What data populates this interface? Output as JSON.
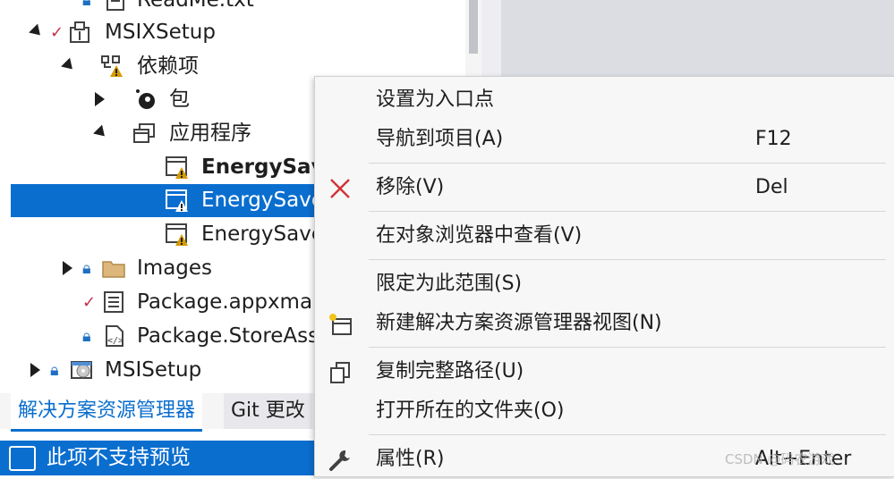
{
  "tree": {
    "rows": [
      {
        "label": "ReadMe.txt",
        "icon": "text-file-icon"
      },
      {
        "label": "MSIXSetup",
        "icon": "package-project-icon"
      },
      {
        "label": "依赖项",
        "icon": "dependencies-warning-icon"
      },
      {
        "label": "包",
        "icon": "package-icon"
      },
      {
        "label": "应用程序",
        "icon": "applications-icon"
      },
      {
        "label": "EnergySav",
        "icon": "app-warning-icon"
      },
      {
        "label": "EnergySave",
        "icon": "app-warning-icon"
      },
      {
        "label": "EnergySave",
        "icon": "app-warning-icon"
      },
      {
        "label": "Images",
        "icon": "folder-icon"
      },
      {
        "label": "Package.appxmar",
        "icon": "manifest-icon"
      },
      {
        "label": "Package.StoreAss",
        "icon": "xml-file-icon"
      },
      {
        "label": "MSISetup",
        "icon": "setup-project-icon"
      }
    ]
  },
  "tabs": {
    "solution_explorer": "解决方案资源管理器",
    "git": "Git 更改"
  },
  "status": {
    "text": "此项不支持预览"
  },
  "menu": {
    "items": [
      {
        "label": "设置为入口点",
        "shortcut": ""
      },
      {
        "label": "导航到项目(A)",
        "shortcut": "F12"
      },
      {
        "label": "移除(V)",
        "shortcut": "Del",
        "icon": "remove-x-icon"
      },
      {
        "label": "在对象浏览器中查看(V)",
        "shortcut": ""
      },
      {
        "label": "限定为此范围(S)",
        "shortcut": ""
      },
      {
        "label": "新建解决方案资源管理器视图(N)",
        "shortcut": "",
        "icon": "new-view-icon"
      },
      {
        "label": "复制完整路径(U)",
        "shortcut": "",
        "icon": "copy-icon"
      },
      {
        "label": "打开所在的文件夹(O)",
        "shortcut": ""
      },
      {
        "label": "属性(R)",
        "shortcut": "Alt+Enter",
        "icon": "wrench-icon"
      }
    ]
  },
  "watermark": "CSDN @码农游戏",
  "colors": {
    "accent": "#0a6ecf",
    "remove": "#d13438",
    "warning": "#d49b00"
  }
}
